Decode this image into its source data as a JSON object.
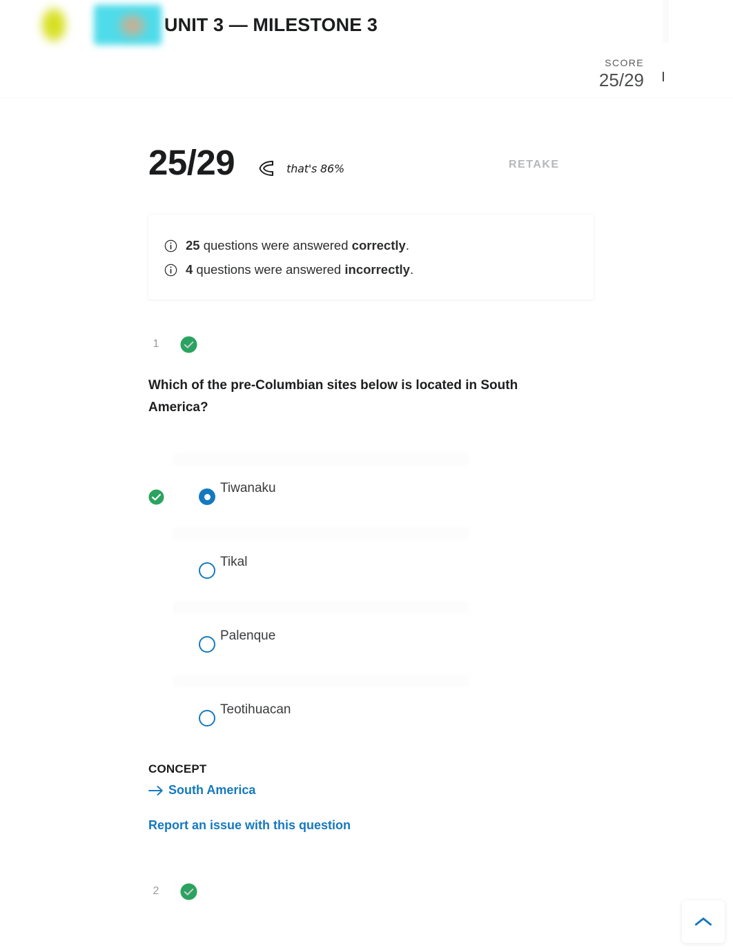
{
  "header": {
    "title": "UNIT 3 — MILESTONE 3",
    "logo_name": "sophia-logo",
    "score_label": "SCORE",
    "score_value": "25/29"
  },
  "summary": {
    "score": "25/29",
    "percent_note": "that's 86%",
    "retake_label": "RETAKE"
  },
  "info_card": {
    "lines": [
      {
        "count": "25",
        "middle": " questions were answered ",
        "emphasis": "correctly",
        "end": "."
      },
      {
        "count": "4",
        "middle": " questions were answered ",
        "emphasis": "incorrectly",
        "end": "."
      }
    ]
  },
  "questions": [
    {
      "number": "1",
      "status": "correct",
      "text": "Which of the pre-Columbian sites below is located in South America?",
      "options": [
        {
          "label": "Tiwanaku",
          "selected": true,
          "correct": true
        },
        {
          "label": "Tikal",
          "selected": false,
          "correct": false
        },
        {
          "label": "Palenque",
          "selected": false,
          "correct": false
        },
        {
          "label": "Teotihuacan",
          "selected": false,
          "correct": false
        }
      ],
      "concept_heading": "CONCEPT",
      "concept_link": "South America",
      "report_link": "Report an issue with this question"
    },
    {
      "number": "2",
      "status": "correct"
    }
  ],
  "scroll_top": {
    "label": "scroll-to-top"
  },
  "colors": {
    "accent_blue": "#1579bf",
    "correct_green": "#2ba360",
    "text_dark": "#1b1c1d",
    "muted": "#9a9b9d"
  }
}
